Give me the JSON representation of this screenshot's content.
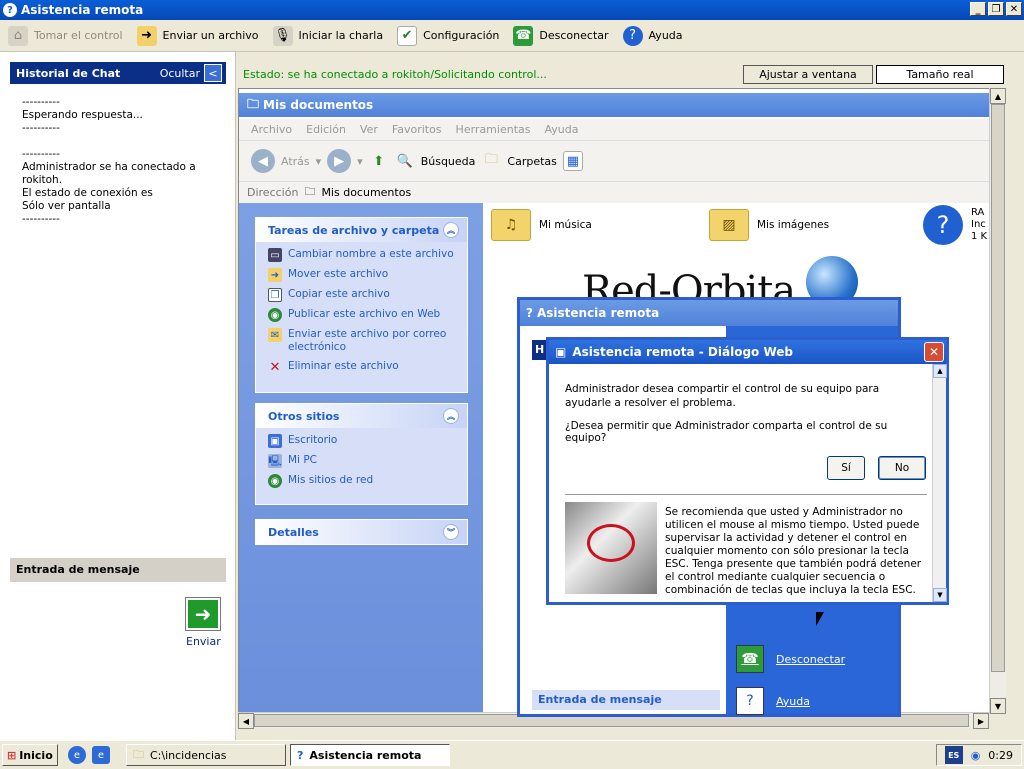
{
  "window": {
    "title": "Asistencia remota"
  },
  "toolbar": {
    "take_control": "Tomar el control",
    "send_file": "Enviar un archivo",
    "start_talk": "Iniciar la charla",
    "settings": "Configuración",
    "disconnect": "Desconectar",
    "help": "Ayuda"
  },
  "chat": {
    "header": "Historial de Chat",
    "hide": "Ocultar",
    "log": "----------\nEsperando respuesta...\n----------\n\n----------\nAdministrador se ha conectado a\nrokitoh.\nEl estado de conexión es\nSólo ver pantalla\n----------",
    "message_header": "Entrada de mensaje",
    "send": "Enviar"
  },
  "status": {
    "text": "Estado: se ha conectado a rokitoh/Solicitando control...",
    "fit_window": "Ajustar a ventana",
    "real_size": "Tamaño real"
  },
  "remote_explorer": {
    "title": "Mis documentos",
    "menu": [
      "Archivo",
      "Edición",
      "Ver",
      "Favoritos",
      "Herramientas",
      "Ayuda"
    ],
    "back": "Atrás",
    "search": "Búsqueda",
    "folders": "Carpetas",
    "address_label": "Dirección",
    "address_value": "Mis documentos",
    "file_tasks_title": "Tareas de archivo y carpeta",
    "file_tasks": [
      "Cambiar nombre a este archivo",
      "Mover este archivo",
      "Copiar este archivo",
      "Publicar este archivo en Web",
      "Enviar este archivo por correo electrónico",
      "Eliminar este archivo"
    ],
    "other_places_title": "Otros sitios",
    "other_places": [
      "Escritorio",
      "Mi PC",
      "Mis sitios de red"
    ],
    "details_title": "Detalles",
    "files": [
      "Mi música",
      "Mis imágenes"
    ],
    "partial_file_lines": [
      "RA",
      "Inc",
      "1 K"
    ]
  },
  "watermark": {
    "text": "Red-Orbita"
  },
  "back_dialog": {
    "title": "Asistencia remota",
    "disconnect": "Desconectar",
    "help": "Ayuda",
    "message_header": "Entrada de mensaje",
    "h": "H"
  },
  "dialog": {
    "title": "Asistencia remota - Diálogo Web",
    "text1": "Administrador desea compartir el control de su equipo para ayudarle a resolver el problema.",
    "text2": "¿Desea permitir que Administrador comparta el control de su equipo?",
    "yes": "Sí",
    "no": "No",
    "note": "Se recomienda que usted y Administrador  no utilicen el mouse al mismo tiempo. Usted puede supervisar la actividad y detener el control en cualquier momento con sólo presionar la tecla ESC. Tenga presente que también podrá detener el control mediante cualquier secuencia o combinación de teclas que incluya la tecla ESC."
  },
  "taskbar": {
    "start": "Inicio",
    "items": [
      "C:\\incidencias",
      "Asistencia remota"
    ],
    "lang": "ES",
    "clock": "0:29"
  }
}
